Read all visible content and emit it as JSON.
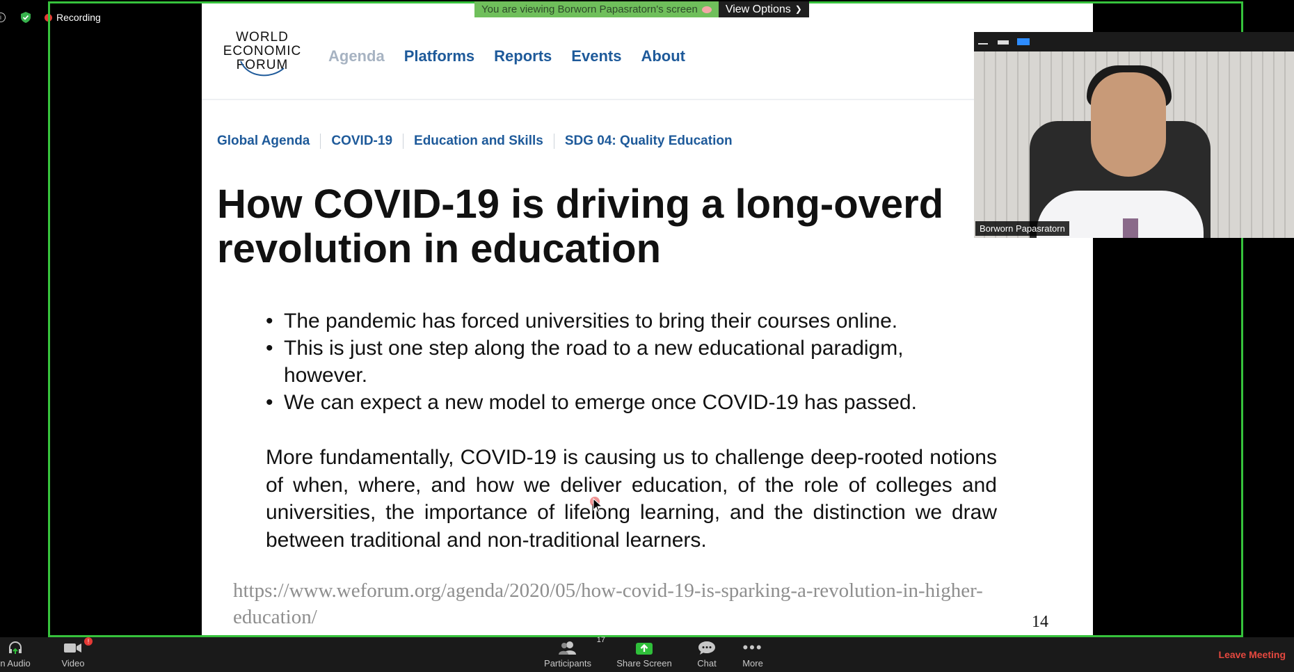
{
  "status": {
    "recording_label": "Recording",
    "colors": {
      "recording_dot": "#e53935",
      "shield": "#37b24d"
    }
  },
  "share_banner": {
    "viewing_text": "You are viewing Borworn Papasratorn's screen",
    "view_options_label": "View Options"
  },
  "slide": {
    "logo_lines": [
      "WORLD",
      "ECONOMIC",
      "FORUM"
    ],
    "nav": [
      "Agenda",
      "Platforms",
      "Reports",
      "Events",
      "About"
    ],
    "breadcrumbs": [
      "Global Agenda",
      "COVID-19",
      "Education and Skills",
      "SDG 04: Quality Education"
    ],
    "headline_line1": "How COVID-19 is driving a long-overd",
    "headline_line2": "revolution in education",
    "bullets": [
      "The pandemic has forced universities to bring their courses online.",
      "This is just one step along the road to a new educational paradigm, however.",
      "We can expect a new model to emerge once COVID-19 has passed."
    ],
    "paragraph": "More fundamentally, COVID-19 is causing us to challenge deep-rooted notions of when, where, and how we deliver education, of the role of colleges and universities, the importance of lifelong learning, and the distinction we draw between traditional and non-traditional learners.",
    "source_line1": "https://www.weforum.org/agenda/2020/05/how-covid-19-is-sparking-a-revolution-in-higher-",
    "source_line2": "education/",
    "page_number": "14"
  },
  "video": {
    "participant_name": "Borworn Papasratorn"
  },
  "toolbar": {
    "audio_label": "n Audio",
    "video_label": "Video",
    "video_badge": "!",
    "participants_label": "Participants",
    "participants_count": "17",
    "share_label": "Share Screen",
    "chat_label": "Chat",
    "more_label": "More",
    "leave_label": "Leave Meeting",
    "colors": {
      "share": "#2fbf3a",
      "leave": "#e5483f"
    }
  }
}
